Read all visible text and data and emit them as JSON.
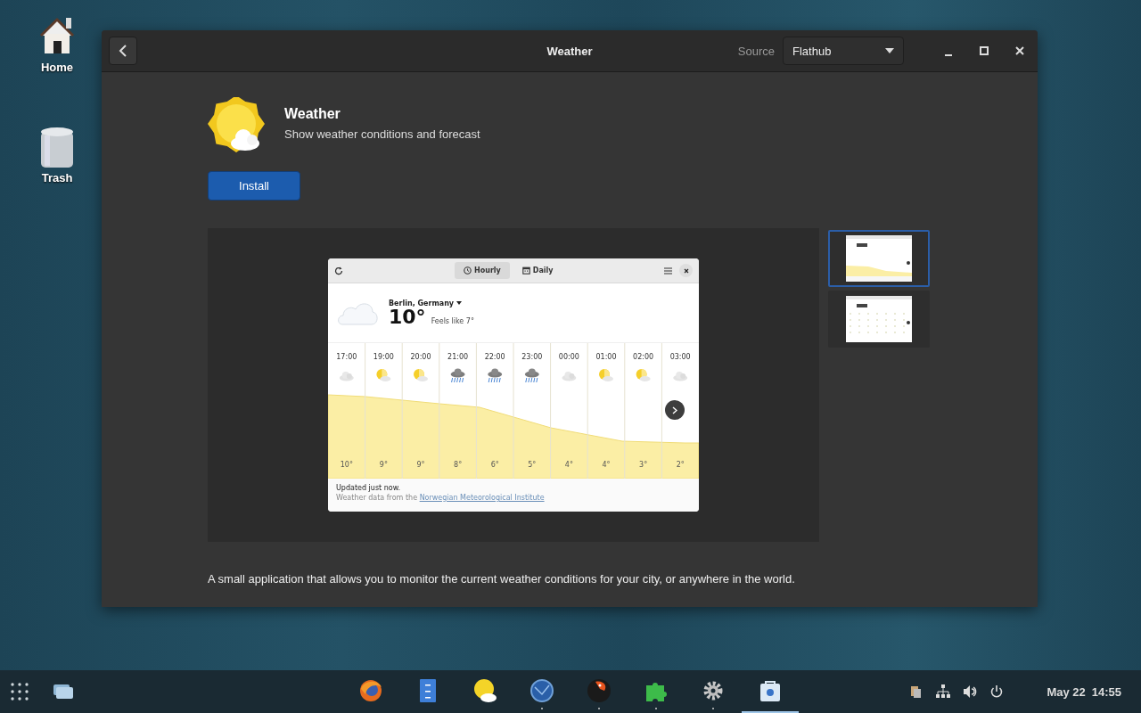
{
  "desktop": {
    "icons": [
      {
        "kind": "home",
        "label": "Home"
      },
      {
        "kind": "trash",
        "label": "Trash"
      }
    ]
  },
  "window": {
    "title": "Weather",
    "source_label": "Source",
    "source": "Flathub"
  },
  "app": {
    "name": "Weather",
    "summary": "Show weather conditions and forecast",
    "install_button": "Install"
  },
  "screenshot": {
    "tabs": [
      {
        "label": "Hourly",
        "kind": "clock",
        "selected": true
      },
      {
        "label": "Daily",
        "kind": "calendar",
        "selected": false
      }
    ],
    "location": "Berlin, Germany",
    "temperature": "10°",
    "feels_like": "Feels like 7°",
    "forecast": {
      "hours": [
        {
          "time": "17:00",
          "kind": "cloudy",
          "temperature": "10°"
        },
        {
          "time": "19:00",
          "kind": "partly-cloudy",
          "temperature": "9°"
        },
        {
          "time": "20:00",
          "kind": "partly-cloudy",
          "temperature": "9°"
        },
        {
          "time": "21:00",
          "kind": "rain",
          "temperature": "8°"
        },
        {
          "time": "22:00",
          "kind": "rain",
          "temperature": "6°"
        },
        {
          "time": "23:00",
          "kind": "rain",
          "temperature": "5°"
        },
        {
          "time": "00:00",
          "kind": "cloudy",
          "temperature": "4°"
        },
        {
          "time": "01:00",
          "kind": "partly-cloudy",
          "temperature": "4°"
        },
        {
          "time": "02:00",
          "kind": "partly-cloudy",
          "temperature": "3°"
        },
        {
          "time": "03:00",
          "kind": "cloudy",
          "temperature": "2°"
        }
      ]
    },
    "updated": "Updated just now.",
    "attribution": "Weather data from the",
    "attribution_link": "Norwegian Meteorological Institute"
  },
  "thumbnails": [
    {
      "kind": "hourly",
      "selected": true
    },
    {
      "kind": "daily",
      "selected": false
    }
  ],
  "description": "A small application that allows you to monitor the current weather conditions for your city, or anywhere in the world.",
  "taskbar": {
    "apps": [
      {
        "kind": "fox",
        "running": false,
        "selected": false
      },
      {
        "kind": "cabinet",
        "running": false,
        "selected": false
      },
      {
        "kind": "sun",
        "running": false,
        "selected": false
      },
      {
        "kind": "globe",
        "running": true,
        "selected": false
      },
      {
        "kind": "bird",
        "running": true,
        "selected": false
      },
      {
        "kind": "puzzle",
        "running": true,
        "selected": false
      },
      {
        "kind": "gear",
        "running": true,
        "selected": false
      },
      {
        "kind": "bag",
        "running": false,
        "selected": true
      }
    ],
    "date": "May 22",
    "time": "14:55"
  }
}
